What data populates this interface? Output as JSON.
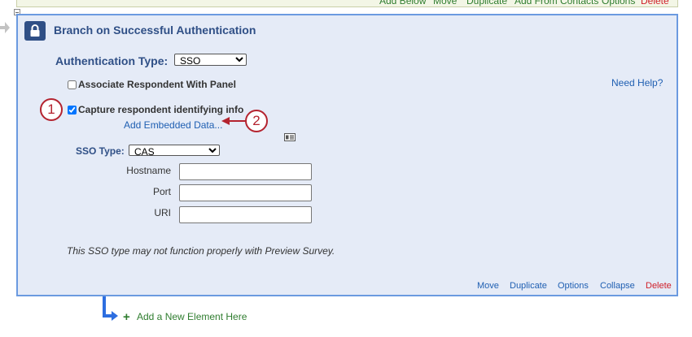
{
  "top_toolbar": {
    "add_below": "Add Below",
    "move": "Move",
    "duplicate": "Duplicate",
    "add_from_contacts": "Add From Contacts",
    "options": "Options",
    "delete": "Delete"
  },
  "block": {
    "title": "Branch on Successful Authentication",
    "auth_type_label": "Authentication Type:",
    "auth_type_value": "SSO",
    "associate_label": "Associate Respondent With Panel",
    "associate_checked": false,
    "need_help": "Need Help?",
    "capture_label": "Capture respondent identifying info",
    "capture_checked": true,
    "add_embedded": "Add Embedded Data...",
    "sso_type_label": "SSO Type:",
    "sso_type_value": "CAS",
    "fields": [
      {
        "label": "Hostname",
        "value": ""
      },
      {
        "label": "Port",
        "value": ""
      },
      {
        "label": "URI",
        "value": ""
      }
    ],
    "note": "This SSO type may not function properly with Preview Survey."
  },
  "callouts": {
    "one": "1",
    "two": "2"
  },
  "footer": {
    "move": "Move",
    "duplicate": "Duplicate",
    "options": "Options",
    "collapse": "Collapse",
    "delete": "Delete"
  },
  "add_element": "Add a New Element Here",
  "colors": {
    "panel_bg": "#e5ebf7",
    "panel_border": "#6b9ae0",
    "title": "#2f4f86",
    "link": "#1f5fb2",
    "delete": "#d0202a",
    "add": "#2f7d2f",
    "callout": "#b4232f"
  }
}
